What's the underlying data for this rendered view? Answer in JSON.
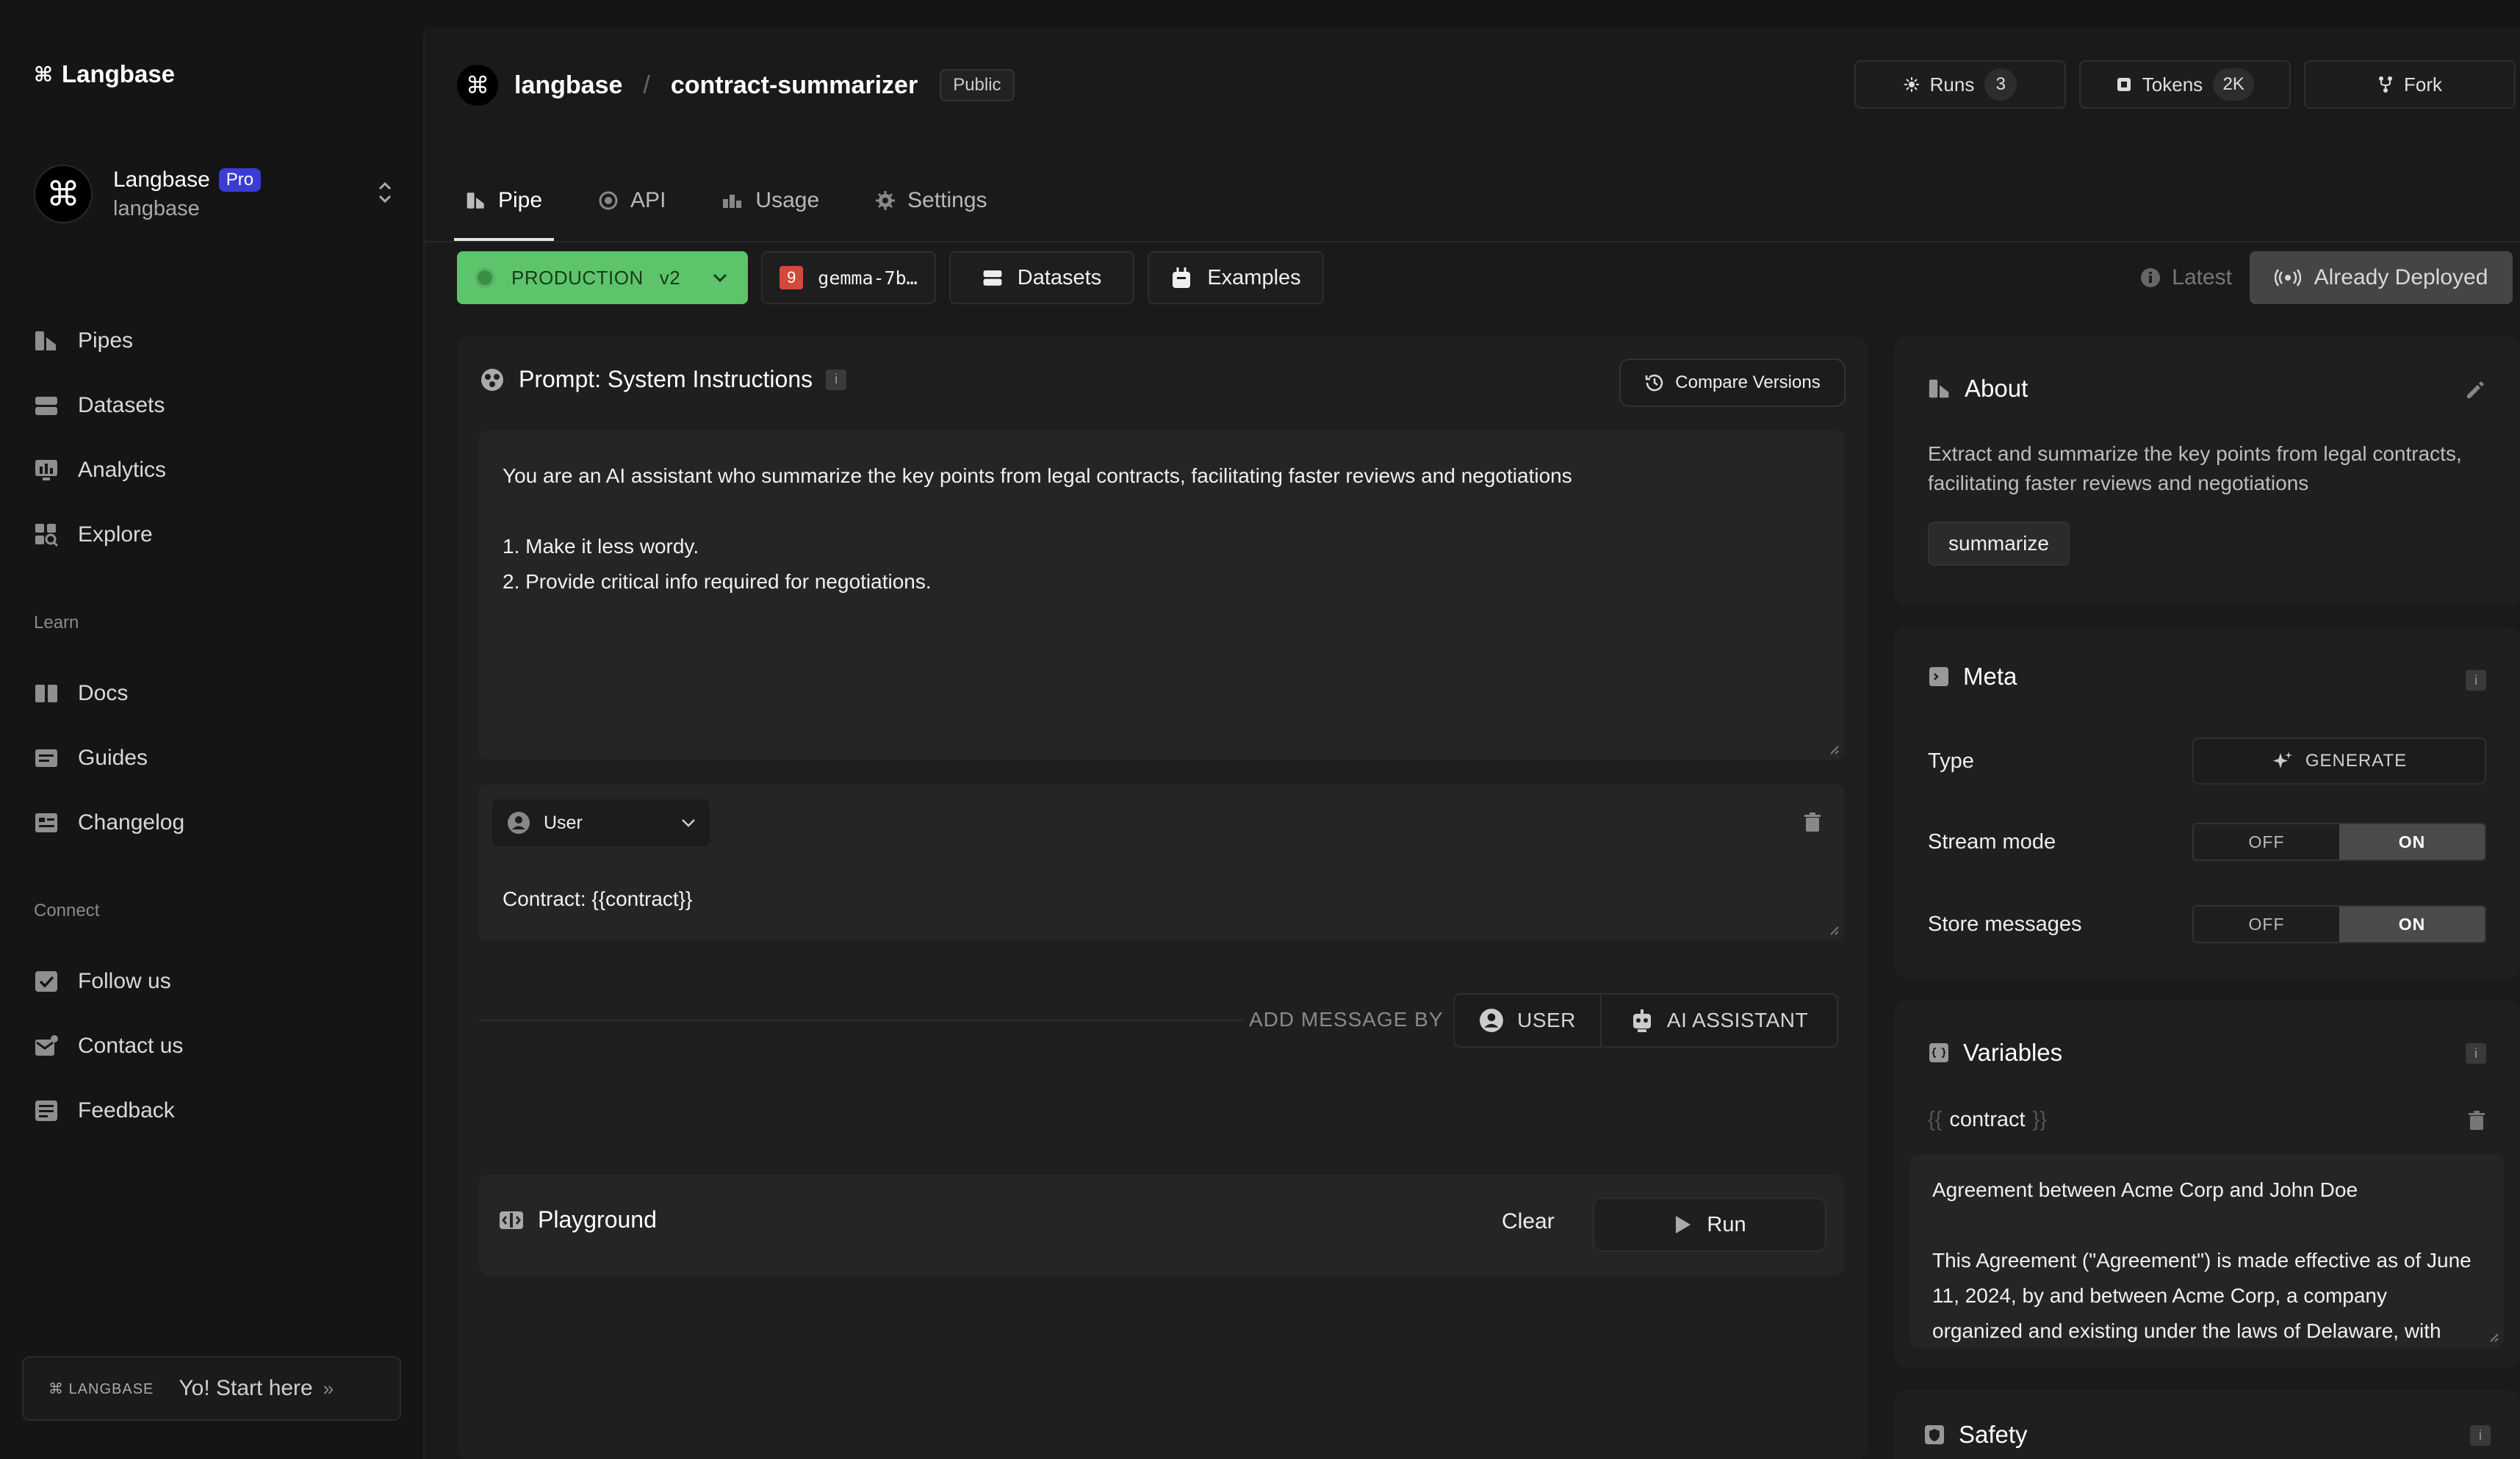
{
  "sidebar": {
    "brand": "Langbase",
    "workspace": {
      "name": "Langbase",
      "badge": "Pro",
      "handle": "langbase"
    },
    "nav": [
      "Pipes",
      "Datasets",
      "Analytics",
      "Explore"
    ],
    "learn_label": "Learn",
    "learn": [
      "Docs",
      "Guides",
      "Changelog"
    ],
    "connect_label": "Connect",
    "connect": [
      "Follow us",
      "Contact us",
      "Feedback"
    ],
    "footer": {
      "logo": "⌘ LANGBASE",
      "cta": "Yo! Start here"
    }
  },
  "header": {
    "org": "langbase",
    "separator": "/",
    "pipe": "contract-summarizer",
    "visibility": "Public",
    "runs_label": "Runs",
    "runs_count": "3",
    "tokens_label": "Tokens",
    "tokens_count": "2K",
    "fork_label": "Fork"
  },
  "tabs": [
    "Pipe",
    "API",
    "Usage",
    "Settings"
  ],
  "toolbar": {
    "env": "PRODUCTION",
    "version": "v2",
    "model_badge": "9",
    "model": "gemma-7b…",
    "datasets": "Datasets",
    "examples": "Examples",
    "latest": "Latest",
    "deploy": "Already Deployed"
  },
  "prompt": {
    "title": "Prompt: System Instructions",
    "compare": "Compare Versions",
    "system_line1": "You are an AI assistant who summarize the key points from legal contracts, facilitating faster reviews and negotiations",
    "system_line2": "1. Make it less wordy.",
    "system_line3": "2. Provide critical info required for negotiations.",
    "role": "User",
    "message": "Contract: {{contract}}",
    "add_label": "ADD MESSAGE BY",
    "add_user": "USER",
    "add_ai": "AI ASSISTANT"
  },
  "playground": {
    "title": "Playground",
    "clear": "Clear",
    "run": "Run"
  },
  "about": {
    "title": "About",
    "description": "Extract and summarize the key points from legal contracts, facilitating faster reviews and negotiations",
    "tag": "summarize"
  },
  "meta": {
    "title": "Meta",
    "type_label": "Type",
    "type_value": "GENERATE",
    "stream_label": "Stream mode",
    "store_label": "Store messages",
    "off": "OFF",
    "on": "ON"
  },
  "variables": {
    "title": "Variables",
    "open_brace": "{{",
    "close_brace": "}}",
    "name": "contract",
    "value_line1": "Agreement between Acme Corp and John Doe",
    "value_line2": "This Agreement (\"Agreement\") is made effective as of June 11, 2024, by and between Acme Corp, a company organized and existing under the laws of Delaware, with"
  },
  "safety": {
    "title": "Safety"
  },
  "colors": {
    "accent_green": "#5ec46c",
    "pro_badge": "#3b3bd6",
    "background": "#151515"
  }
}
